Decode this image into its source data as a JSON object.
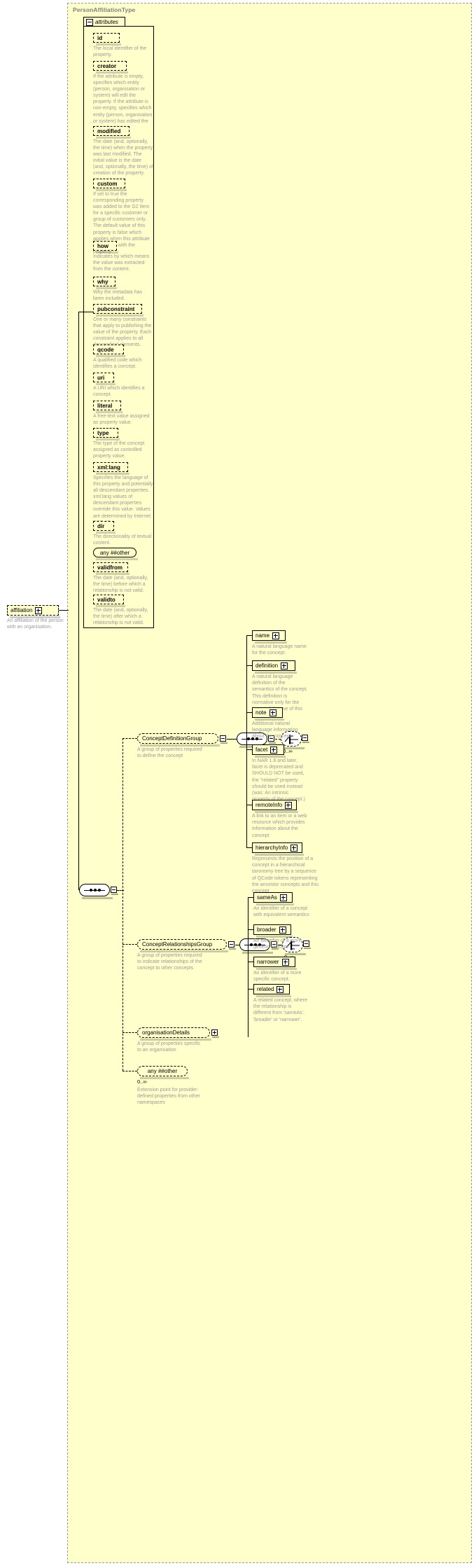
{
  "diagram": {
    "type_name": "PersonAffiliationType",
    "attributes_label": "attributes"
  },
  "left_element": {
    "name": "affiliation",
    "doc": "An affiliation of the person with an organisation."
  },
  "attributes": [
    {
      "name": "id",
      "doc": "The local identifier of the property."
    },
    {
      "name": "creator",
      "doc": "If the attribute is empty, specifies which entity (person, organisation or system) will edit the property. If the attribute is non-empty, specifies which entity (person, organisation or system) has edited the property."
    },
    {
      "name": "modified",
      "doc": "The date (and, optionally, the time) when the property was last modified. The initial value is the date (and, optionally, the time) of creation of the property."
    },
    {
      "name": "custom",
      "doc": "If set to true the corresponding property was added to the G2 Item for a specific customer or group of customers only. The default value of this property is false which applies when this attribute is not used with the property."
    },
    {
      "name": "how",
      "doc": "Indicates by which means the value was extracted from the content."
    },
    {
      "name": "why",
      "doc": "Why the metadata has been included."
    },
    {
      "name": "pubconstraint",
      "doc": "One or many constraints that apply to publishing the value of the property. Each constraint applies to all descendant elements."
    },
    {
      "name": "qcode",
      "doc": "A qualified code which identifies a concept."
    },
    {
      "name": "uri",
      "doc": "A URI which identifies a concept."
    },
    {
      "name": "literal",
      "doc": "A free-text value assigned as property value."
    },
    {
      "name": "type",
      "doc": "The type of the concept assigned as controlled property value."
    },
    {
      "name": "xml:lang",
      "doc": "Specifies the language of this property and potentially all descendant properties. xml:lang values of descendant properties override this value. Values are determined by Internet BCP 47."
    },
    {
      "name": "dir",
      "doc": "The directionality of textual content."
    },
    {
      "name": "any  ##other",
      "doc": "",
      "kind": "any"
    },
    {
      "name": "validfrom",
      "doc": "The date (and, optionally, the time) before which a relationship is not valid."
    },
    {
      "name": "validto",
      "doc": "The date (and, optionally, the time) after which a relationship is not valid."
    }
  ],
  "groups": [
    {
      "name": "ConceptDefinitionGroup",
      "doc": "A group of properites required to define the concept",
      "occurrence": "0..∞",
      "members": [
        {
          "name": "name",
          "doc": "A natural language name for the concept."
        },
        {
          "name": "definition",
          "doc": "A natural language definition of the semantics of the concept. This definition is normative only for the scope of the use of this concept."
        },
        {
          "name": "note",
          "doc": "Additional natural language information about the concept."
        },
        {
          "name": "facet",
          "doc": "In NAR 1.8 and later, facet is deprecated and SHOULD NOT be used, the \"related\" property should be used instead (was: An intrinsic property of the concept.)"
        },
        {
          "name": "remoteInfo",
          "doc": "A link to an item or a web resource which provides information about the concept"
        },
        {
          "name": "hierarchyInfo",
          "doc": "Represents the position of a concept in a hierarchical taxonomy tree by a sequence of QCode tokens representing the ancestor concepts and this concept"
        }
      ]
    },
    {
      "name": "ConceptRelationshipsGroup",
      "doc": "A group of properties required to indicate relationships of the concept to other concepts",
      "occurrence": "0..∞",
      "members": [
        {
          "name": "sameAs",
          "doc": "An identifier of a concept with equivalent semantics"
        },
        {
          "name": "broader",
          "doc": "An identifier of a more generic concept."
        },
        {
          "name": "narrower",
          "doc": "An identifier of a more specific concept."
        },
        {
          "name": "related",
          "doc": "A related concept, where the relationship is different from 'sameAs', 'broader' or 'narrower'."
        }
      ]
    }
  ],
  "tail": [
    {
      "name": "organisationDetails",
      "doc": "A group of properties specific to an organisation",
      "kind": "group"
    },
    {
      "name": "any  ##other",
      "occurrence": "0..∞",
      "doc": "Extension point for provider-defined properties from other namespaces",
      "kind": "any"
    }
  ]
}
